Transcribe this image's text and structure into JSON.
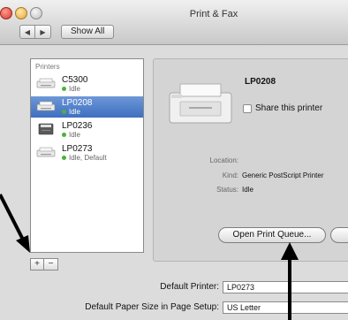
{
  "window": {
    "title": "Print & Fax"
  },
  "toolbar": {
    "back_icon": "◀",
    "forward_icon": "▶",
    "show_all": "Show All"
  },
  "printers": {
    "header": "Printers",
    "items": [
      {
        "name": "C5300",
        "status": "Idle",
        "selected": false,
        "icon": "printer-icon"
      },
      {
        "name": "LP0208",
        "status": "Idle",
        "selected": true,
        "icon": "printer-icon"
      },
      {
        "name": "LP0236",
        "status": "Idle",
        "selected": false,
        "icon": "tower-printer-icon"
      },
      {
        "name": "LP0273",
        "status": "Idle, Default",
        "selected": false,
        "icon": "printer-icon"
      }
    ],
    "add": "+",
    "remove": "−"
  },
  "detail": {
    "name": "LP0208",
    "share_label": "Share this printer",
    "location_label": "Location:",
    "location_value": "",
    "kind_label": "Kind:",
    "kind_value": "Generic PostScript Printer",
    "status_label": "Status:",
    "status_value": "Idle",
    "open_queue": "Open Print Queue..."
  },
  "defaults": {
    "default_printer_label": "Default Printer:",
    "default_printer_value": "LP0273",
    "paper_size_label": "Default Paper Size in Page Setup:",
    "paper_size_value": "US Letter"
  },
  "colors": {
    "selection": "#3e6fc0",
    "status_dot": "#4caf3d",
    "arrow": "#000000"
  }
}
